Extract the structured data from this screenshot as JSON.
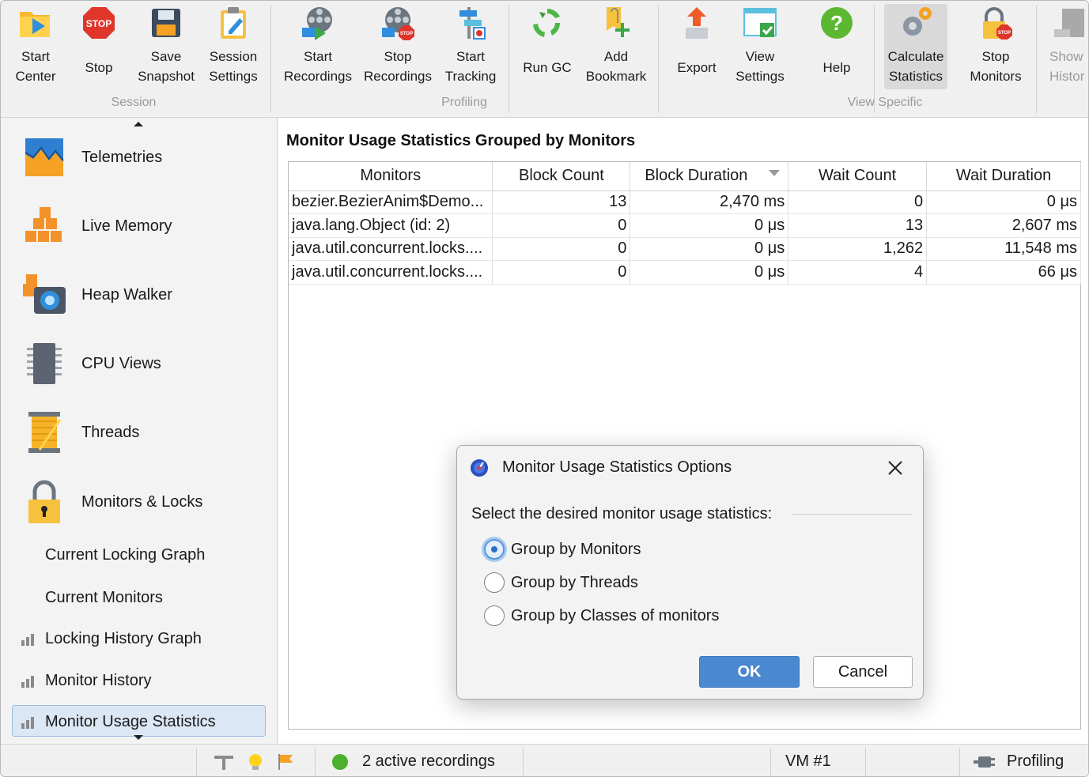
{
  "toolbar": {
    "groups": {
      "session": "Session",
      "profiling": "Profiling",
      "view_specific": "View Specific"
    },
    "buttons": {
      "start_center": "Start\nCenter",
      "stop": "Stop",
      "save_snapshot": "Save\nSnapshot",
      "session_settings": "Session\nSettings",
      "start_recordings": "Start\nRecordings",
      "stop_recordings": "Stop\nRecordings",
      "start_tracking": "Start\nTracking",
      "run_gc": "Run GC",
      "add_bookmark": "Add\nBookmark",
      "export": "Export",
      "view_settings": "View\nSettings",
      "help": "Help",
      "calculate_statistics": "Calculate\nStatistics",
      "stop_monitors": "Stop\nMonitors",
      "show_history": "Show\nHistor"
    },
    "icon_text": {
      "stop": "STOP",
      "small_stop": "STOP"
    }
  },
  "sidebar": {
    "items": [
      {
        "label": "Telemetries",
        "icon": "telemetries-icon"
      },
      {
        "label": "Live Memory",
        "icon": "live-memory-icon"
      },
      {
        "label": "Heap Walker",
        "icon": "heap-walker-icon"
      },
      {
        "label": "CPU Views",
        "icon": "cpu-views-icon"
      },
      {
        "label": "Threads",
        "icon": "threads-icon"
      },
      {
        "label": "Monitors & Locks",
        "icon": "lock-icon"
      }
    ],
    "subitems": [
      {
        "label": "Current Locking Graph"
      },
      {
        "label": "Current Monitors"
      },
      {
        "label": "Locking History Graph"
      },
      {
        "label": "Monitor History"
      },
      {
        "label": "Monitor Usage Statistics",
        "selected": true
      }
    ]
  },
  "main": {
    "title": "Monitor Usage Statistics Grouped by Monitors",
    "columns": [
      "Monitors",
      "Block Count",
      "Block Duration",
      "Wait Count",
      "Wait Duration"
    ],
    "sorted_column": "Block Duration",
    "rows": [
      [
        "bezier.BezierAnim$Demo...",
        "13",
        "2,470 ms",
        "0",
        "0 μs"
      ],
      [
        "java.lang.Object (id: 2)",
        "0",
        "0 μs",
        "13",
        "2,607 ms"
      ],
      [
        "java.util.concurrent.locks....",
        "0",
        "0 μs",
        "1,262",
        "11,548 ms"
      ],
      [
        "java.util.concurrent.locks....",
        "0",
        "0 μs",
        "4",
        "66 μs"
      ]
    ]
  },
  "dialog": {
    "title": "Monitor Usage Statistics Options",
    "prompt": "Select the desired monitor usage statistics:",
    "options": [
      {
        "label": "Group by Monitors",
        "selected": true
      },
      {
        "label": "Group by Threads",
        "selected": false
      },
      {
        "label": "Group by Classes of monitors",
        "selected": false
      }
    ],
    "ok": "OK",
    "cancel": "Cancel"
  },
  "statusbar": {
    "recordings": "2 active recordings",
    "vm": "VM #1",
    "mode": "Profiling"
  },
  "colors": {
    "accent_blue": "#4a88cf",
    "selection": "#dce7f5",
    "recording_green": "#2e9e2e"
  }
}
